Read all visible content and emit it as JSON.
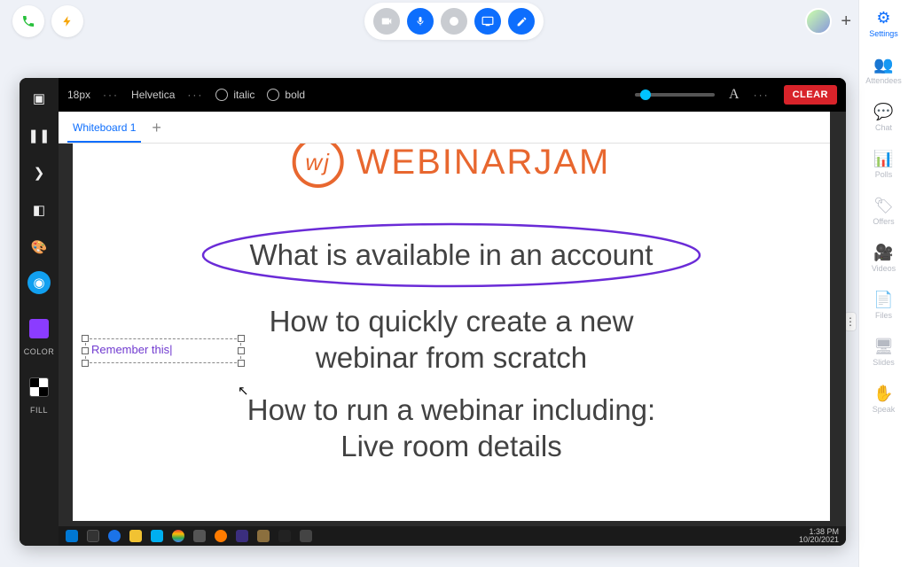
{
  "top_toolbar": {
    "font_size": "18px",
    "font_family": "Helvetica",
    "italic_label": "italic",
    "bold_label": "bold",
    "clear_label": "CLEAR"
  },
  "tabs": {
    "active": "Whiteboard 1"
  },
  "tool_strip": {
    "color_label": "COLOR",
    "fill_label": "FILL",
    "color_hex": "#8b3cff"
  },
  "slide": {
    "brand_text": "WEBINARJAM",
    "brand_mark": "wj",
    "line1": "What is available in an account",
    "line2": "How to quickly create a new\nwebinar from scratch",
    "line3": "How to run a webinar including:\nLive room details",
    "annotation_text": "Remember this"
  },
  "right_rail": {
    "settings": "Settings",
    "attendees": "Attendees",
    "chat": "Chat",
    "polls": "Polls",
    "offers": "Offers",
    "videos": "Videos",
    "files": "Files",
    "slides": "Slides",
    "speak": "Speak"
  },
  "taskbar": {
    "time": "1:38 PM",
    "date": "10/20/2021"
  },
  "colors": {
    "brand": "#e8672f",
    "ellipse": "#6a2bd7",
    "accent_blue": "#0d6efd"
  }
}
